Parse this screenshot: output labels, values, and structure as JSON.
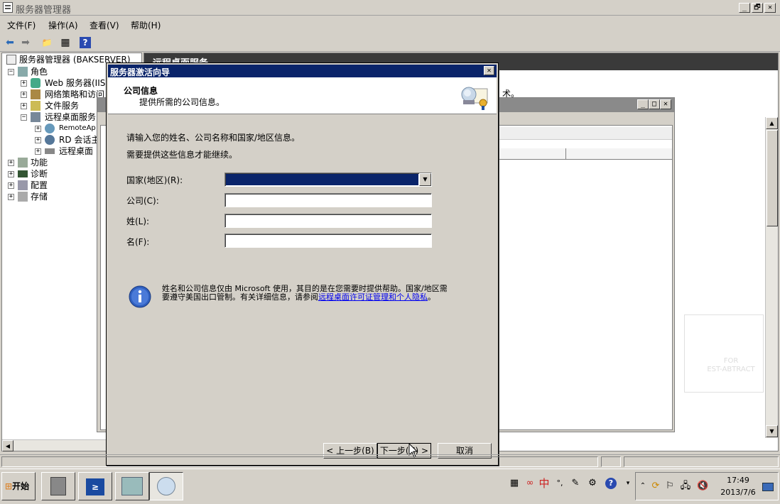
{
  "window": {
    "title": "服务器管理器",
    "controls": [
      "_",
      "🗗",
      "✕"
    ]
  },
  "menu": {
    "file": "文件(F)",
    "action": "操作(A)",
    "view": "查看(V)",
    "help": "帮助(H)"
  },
  "toolbar": {
    "back": "⬅",
    "forward": "➡",
    "up": "📁",
    "show": "▦",
    "help": "?"
  },
  "tree": {
    "root": "服务器管理器 (BAKSERVER)",
    "roles": "角色",
    "web": "Web 服务器(IIS",
    "nps": "网络策略和访问",
    "file": "文件服务",
    "rds": "远程桌面服务",
    "remoteapp": "RemoteAp",
    "rdhost": "RD 会话主",
    "rdlic": "远程桌面",
    "features": "功能",
    "diag": "诊断",
    "config": "配置",
    "storage": "存储"
  },
  "right": {
    "header": "远程桌面服务",
    "fragment": "术。",
    "watermark": "FOR\nEST-ABTRACT"
  },
  "dialog": {
    "title": "服务器激活向导",
    "heading": "公司信息",
    "subheading": "提供所需的公司信息。",
    "intro1": "请输入您的姓名、公司名称和国家/地区信息。",
    "intro2": "需要提供这些信息才能继续。",
    "country_label": "国家(地区)(R):",
    "country_value": "",
    "company_label": "公司(C):",
    "company_value": "",
    "lastname_label": "姓(L):",
    "lastname_value": "",
    "firstname_label": "名(F):",
    "firstname_value": "",
    "info_text": "姓名和公司信息仅由 Microsoft 使用，其目的是在您需要时提供帮助。国家/地区需要遵守美国出口管制。有关详细信息，请参阅",
    "info_link": "远程桌面许可证管理和个人隐私",
    "info_end": "。",
    "back": "< 上一步(B)",
    "next": "下一步(N) >",
    "cancel": "取消"
  },
  "taskbar": {
    "start": "开始",
    "ime": "中",
    "punct": "°,",
    "time": "17:49",
    "date": "2013/7/6"
  }
}
